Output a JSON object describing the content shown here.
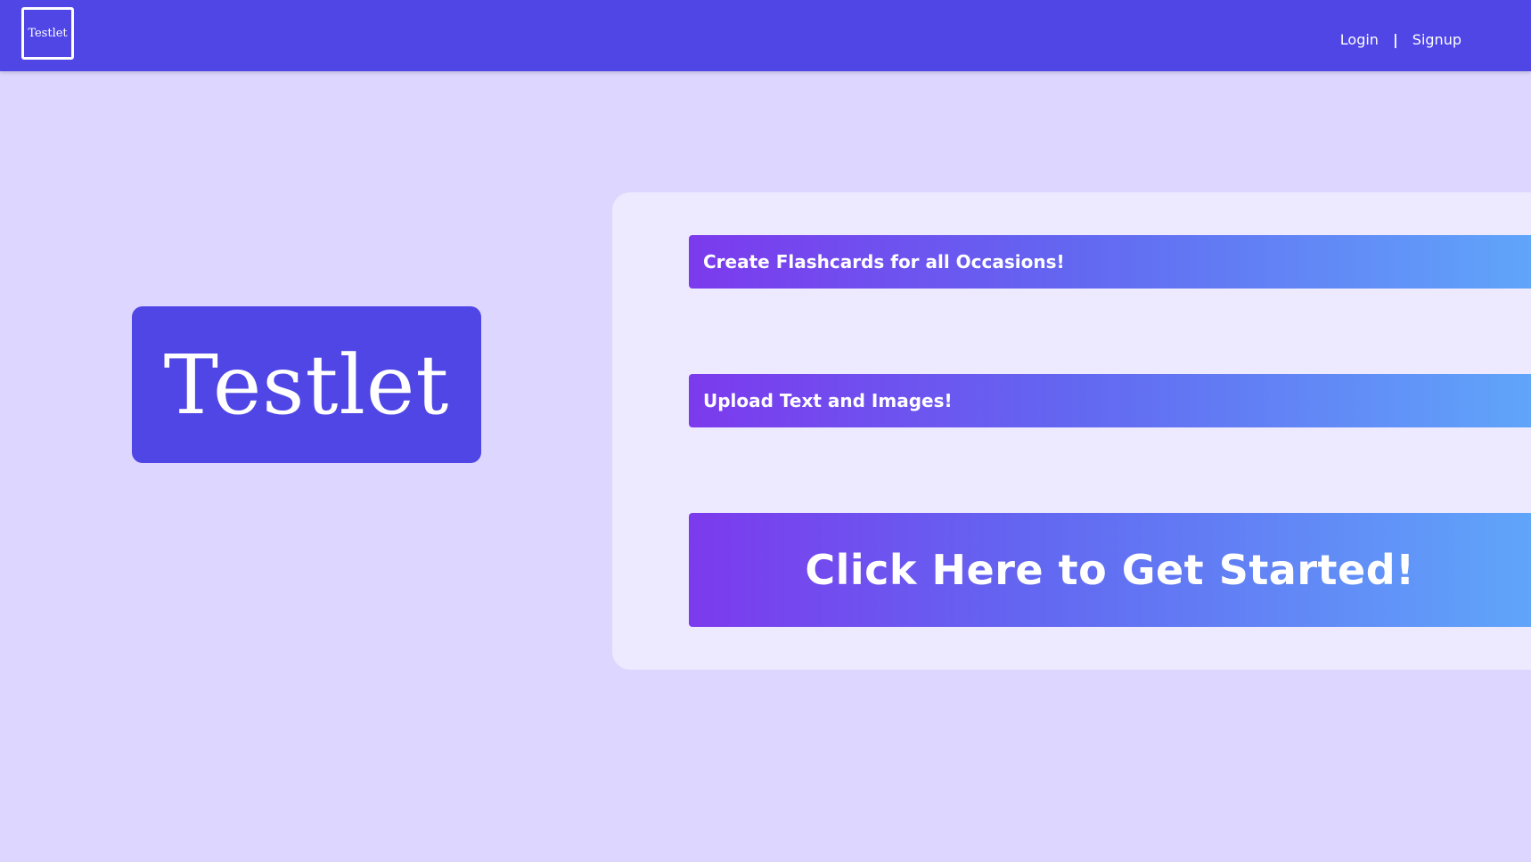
{
  "navbar": {
    "logo_text": "Testlet",
    "login_label": "Login",
    "separator": "|",
    "signup_label": "Signup",
    "background_color": "#4f46e5"
  },
  "hero": {
    "logo_text": "Testlet"
  },
  "features": {
    "item_1": "Create Flashcards for all Occasions!",
    "item_2": "Upload Text and Images!"
  },
  "cta": {
    "label": "Click Here to Get Started!"
  },
  "colors": {
    "page_background": "#ddd6fe",
    "panel_background": "#ede9fe",
    "gradient_start": "#7c3aed",
    "gradient_end": "#60a5fa"
  }
}
